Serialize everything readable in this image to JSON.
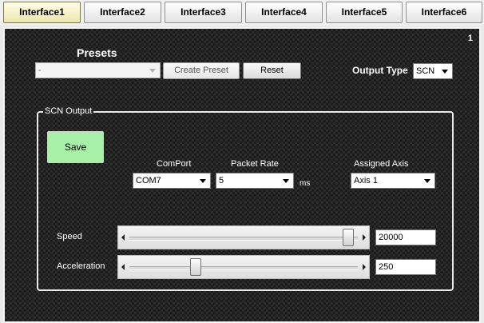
{
  "tabs": [
    {
      "label": "Interface1",
      "active": true
    },
    {
      "label": "Interface2",
      "active": false
    },
    {
      "label": "Interface3",
      "active": false
    },
    {
      "label": "Interface4",
      "active": false
    },
    {
      "label": "Interface5",
      "active": false
    },
    {
      "label": "Interface6",
      "active": false
    }
  ],
  "panel": {
    "number": "1",
    "presets": {
      "title": "Presets",
      "selected_value": "-",
      "create_label": "Create Preset",
      "reset_label": "Reset"
    },
    "output_type": {
      "label": "Output Type",
      "selected_value": "SCN"
    },
    "scn_output": {
      "title": "SCN Output",
      "save_label": "Save",
      "comport": {
        "label": "ComPort",
        "selected_value": "COM7"
      },
      "packet_rate": {
        "label": "Packet Rate",
        "selected_value": "5",
        "unit": "ms"
      },
      "assigned_axis": {
        "label": "Assigned Axis",
        "selected_value": "Axis 1"
      },
      "speed": {
        "label": "Speed",
        "value": "20000",
        "slider_fraction": 0.98
      },
      "acceleration": {
        "label": "Acceleration",
        "value": "250",
        "slider_fraction": 0.28
      }
    }
  },
  "colors": {
    "active_tab": "#ece6ad",
    "save_button": "#a7f0a7",
    "panel_background": "#2a2a2a"
  }
}
